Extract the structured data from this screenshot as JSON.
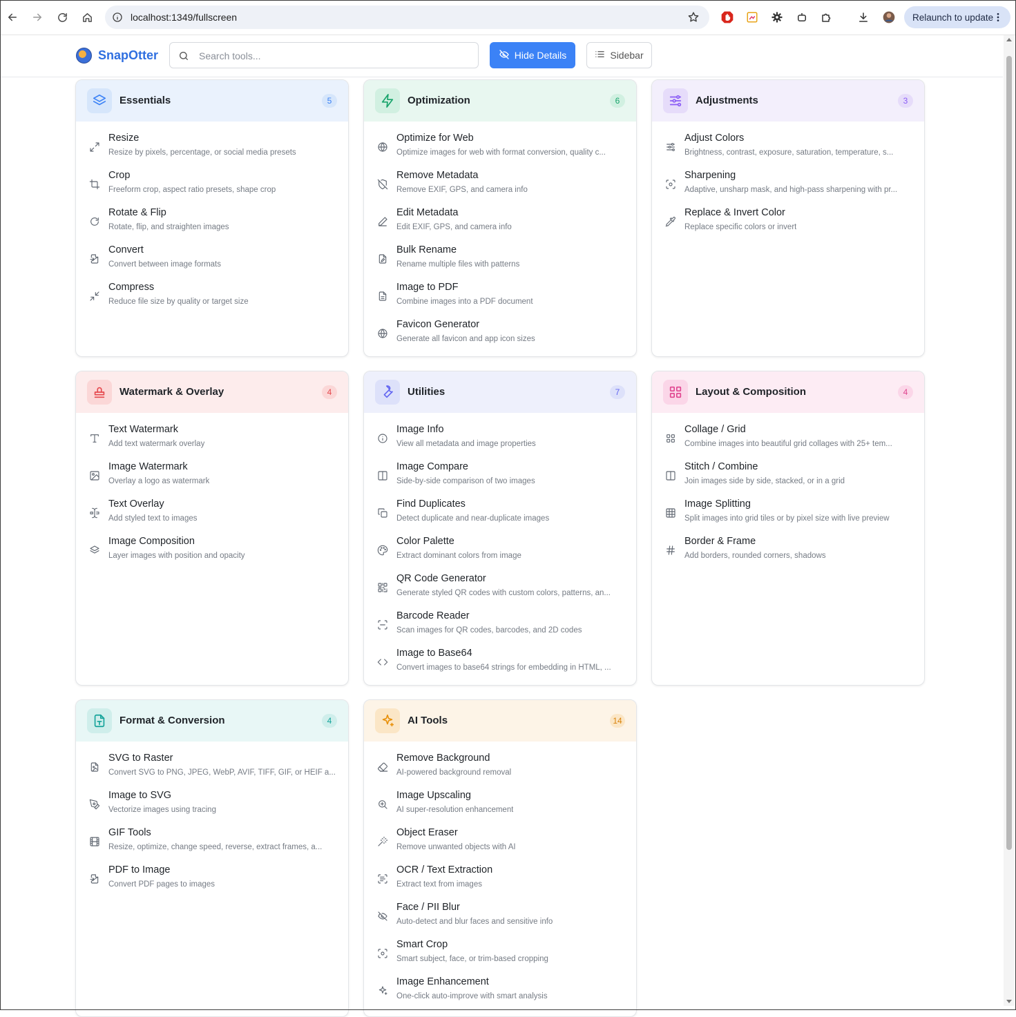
{
  "browser": {
    "url": "localhost:1349/fullscreen",
    "relaunch_label": "Relaunch to update"
  },
  "app": {
    "name": "SnapOtter",
    "search_placeholder": "Search tools...",
    "hide_details_label": "Hide Details",
    "sidebar_label": "Sidebar"
  },
  "colors": {
    "brand": "#2f6fe0",
    "primary_button": "#3b82f6"
  },
  "categories": [
    {
      "title": "Essentials",
      "count": "5",
      "icon": "layers-icon",
      "head_bg": "#eaf2fd",
      "icon_bg": "#d6e6fb",
      "icon_color": "#3b82f6",
      "badge_bg": "#d6e6fb",
      "badge_color": "#3b82f6",
      "tools": [
        {
          "name": "Resize",
          "desc": "Resize by pixels, percentage, or social media presets",
          "icon": "expand-arrows-icon"
        },
        {
          "name": "Crop",
          "desc": "Freeform crop, aspect ratio presets, shape crop",
          "icon": "crop-icon"
        },
        {
          "name": "Rotate & Flip",
          "desc": "Rotate, flip, and straighten images",
          "icon": "rotate-icon"
        },
        {
          "name": "Convert",
          "desc": "Convert between image formats",
          "icon": "file-convert-icon"
        },
        {
          "name": "Compress",
          "desc": "Reduce file size by quality or target size",
          "icon": "shrink-arrows-icon"
        }
      ]
    },
    {
      "title": "Optimization",
      "count": "6",
      "icon": "lightning-icon",
      "head_bg": "#e8f7f0",
      "icon_bg": "#d1f0e1",
      "icon_color": "#16a36a",
      "badge_bg": "#d1f0e1",
      "badge_color": "#16a36a",
      "tools": [
        {
          "name": "Optimize for Web",
          "desc": "Optimize images for web with format conversion, quality c...",
          "icon": "globe-icon"
        },
        {
          "name": "Remove Metadata",
          "desc": "Remove EXIF, GPS, and camera info",
          "icon": "shield-off-icon"
        },
        {
          "name": "Edit Metadata",
          "desc": "Edit EXIF, GPS, and camera info",
          "icon": "pencil-icon"
        },
        {
          "name": "Bulk Rename",
          "desc": "Rename multiple files with patterns",
          "icon": "file-edit-icon"
        },
        {
          "name": "Image to PDF",
          "desc": "Combine images into a PDF document",
          "icon": "file-text-icon"
        },
        {
          "name": "Favicon Generator",
          "desc": "Generate all favicon and app icon sizes",
          "icon": "globe-icon"
        }
      ]
    },
    {
      "title": "Adjustments",
      "count": "3",
      "icon": "sliders-icon",
      "head_bg": "#f3effc",
      "icon_bg": "#e6dcfa",
      "icon_color": "#8b5cf6",
      "badge_bg": "#e6dcfa",
      "badge_color": "#8b5cf6",
      "tools": [
        {
          "name": "Adjust Colors",
          "desc": "Brightness, contrast, exposure, saturation, temperature, s...",
          "icon": "sliders-icon"
        },
        {
          "name": "Sharpening",
          "desc": "Adaptive, unsharp mask, and high-pass sharpening with pr...",
          "icon": "focus-icon"
        },
        {
          "name": "Replace & Invert Color",
          "desc": "Replace specific colors or invert",
          "icon": "eyedropper-icon"
        }
      ]
    },
    {
      "title": "Watermark & Overlay",
      "count": "4",
      "icon": "stamp-icon",
      "head_bg": "#fdecec",
      "icon_bg": "#fbd7d7",
      "icon_color": "#e5484d",
      "badge_bg": "#fbd7d7",
      "badge_color": "#e5484d",
      "tools": [
        {
          "name": "Text Watermark",
          "desc": "Add text watermark overlay",
          "icon": "type-icon"
        },
        {
          "name": "Image Watermark",
          "desc": "Overlay a logo as watermark",
          "icon": "image-icon"
        },
        {
          "name": "Text Overlay",
          "desc": "Add styled text to images",
          "icon": "text-cursor-icon"
        },
        {
          "name": "Image Composition",
          "desc": "Layer images with position and opacity",
          "icon": "layers-icon"
        }
      ]
    },
    {
      "title": "Utilities",
      "count": "7",
      "icon": "wrench-icon",
      "head_bg": "#eef0fc",
      "icon_bg": "#dde1fa",
      "icon_color": "#6366f1",
      "badge_bg": "#dde1fa",
      "badge_color": "#6366f1",
      "tools": [
        {
          "name": "Image Info",
          "desc": "View all metadata and image properties",
          "icon": "info-icon"
        },
        {
          "name": "Image Compare",
          "desc": "Side-by-side comparison of two images",
          "icon": "columns-icon"
        },
        {
          "name": "Find Duplicates",
          "desc": "Detect duplicate and near-duplicate images",
          "icon": "copy-icon"
        },
        {
          "name": "Color Palette",
          "desc": "Extract dominant colors from image",
          "icon": "palette-icon"
        },
        {
          "name": "QR Code Generator",
          "desc": "Generate styled QR codes with custom colors, patterns, an...",
          "icon": "qr-code-icon"
        },
        {
          "name": "Barcode Reader",
          "desc": "Scan images for QR codes, barcodes, and 2D codes",
          "icon": "scan-icon"
        },
        {
          "name": "Image to Base64",
          "desc": "Convert images to base64 strings for embedding in HTML, ...",
          "icon": "code-icon"
        }
      ]
    },
    {
      "title": "Layout & Composition",
      "count": "4",
      "icon": "grid-icon",
      "head_bg": "#fdecf4",
      "icon_bg": "#fbd6e8",
      "icon_color": "#e0458f",
      "badge_bg": "#fbd6e8",
      "badge_color": "#e0458f",
      "tools": [
        {
          "name": "Collage / Grid",
          "desc": "Combine images into beautiful grid collages with 25+ tem...",
          "icon": "grid-icon"
        },
        {
          "name": "Stitch / Combine",
          "desc": "Join images side by side, stacked, or in a grid",
          "icon": "columns-icon"
        },
        {
          "name": "Image Splitting",
          "desc": "Split images into grid tiles or by pixel size with live preview",
          "icon": "table-grid-icon"
        },
        {
          "name": "Border & Frame",
          "desc": "Add borders, rounded corners, shadows",
          "icon": "hash-frame-icon"
        }
      ]
    },
    {
      "title": "Format & Conversion",
      "count": "4",
      "icon": "file-type-icon",
      "head_bg": "#e8f7f6",
      "icon_bg": "#cfeeeb",
      "icon_color": "#14a39a",
      "badge_bg": "#cfeeeb",
      "badge_color": "#14a39a",
      "tools": [
        {
          "name": "SVG to Raster",
          "desc": "Convert SVG to PNG, JPEG, WebP, AVIF, TIFF, GIF, or HEIF a...",
          "icon": "file-image-icon"
        },
        {
          "name": "Image to SVG",
          "desc": "Vectorize images using tracing",
          "icon": "pen-tool-icon"
        },
        {
          "name": "GIF Tools",
          "desc": "Resize, optimize, change speed, reverse, extract frames, a...",
          "icon": "film-icon"
        },
        {
          "name": "PDF to Image",
          "desc": "Convert PDF pages to images",
          "icon": "file-convert-icon"
        }
      ]
    },
    {
      "title": "AI Tools",
      "count": "14",
      "icon": "sparkles-icon",
      "head_bg": "#fdf4e7",
      "icon_bg": "#fbe6c6",
      "icon_color": "#e8910c",
      "badge_bg": "#fbe6c6",
      "badge_color": "#d9830a",
      "tools": [
        {
          "name": "Remove Background",
          "desc": "AI-powered background removal",
          "icon": "eraser-icon"
        },
        {
          "name": "Image Upscaling",
          "desc": "AI super-resolution enhancement",
          "icon": "zoom-in-icon"
        },
        {
          "name": "Object Eraser",
          "desc": "Remove unwanted objects with AI",
          "icon": "magic-wand-icon"
        },
        {
          "name": "OCR / Text Extraction",
          "desc": "Extract text from images",
          "icon": "scan-text-icon"
        },
        {
          "name": "Face / PII Blur",
          "desc": "Auto-detect and blur faces and sensitive info",
          "icon": "eye-off-icon"
        },
        {
          "name": "Smart Crop",
          "desc": "Smart subject, face, or trim-based cropping",
          "icon": "focus-icon"
        },
        {
          "name": "Image Enhancement",
          "desc": "One-click auto-improve with smart analysis",
          "icon": "sparkles-icon"
        }
      ]
    }
  ]
}
